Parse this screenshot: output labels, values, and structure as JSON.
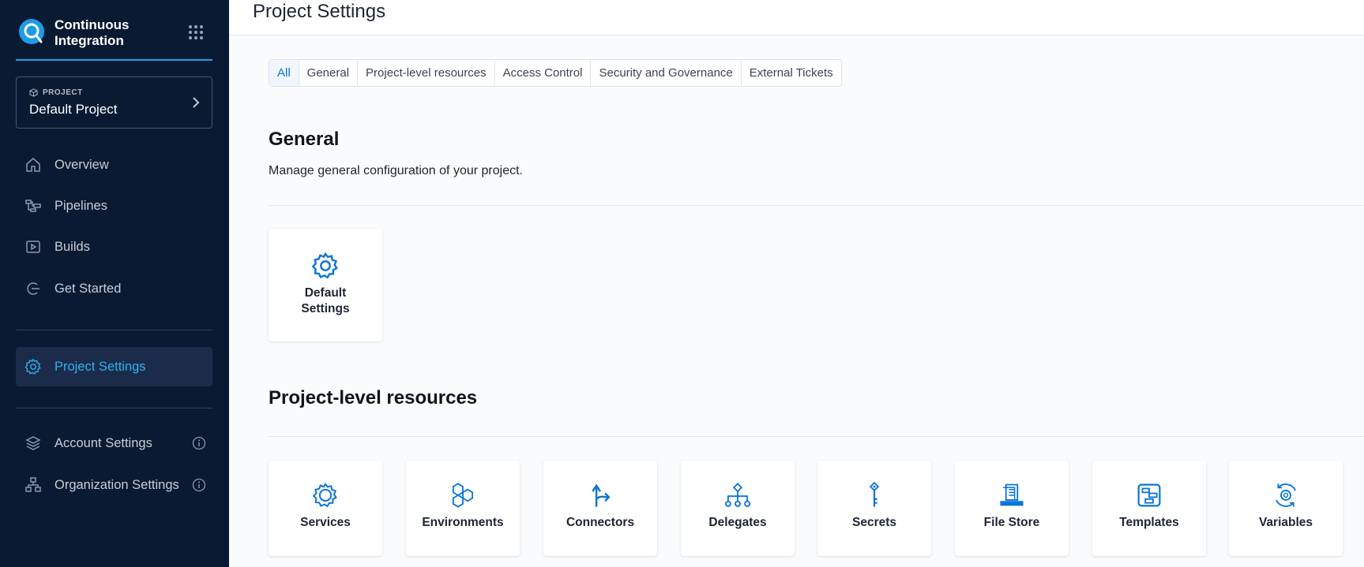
{
  "app": {
    "title": "Continuous Integration"
  },
  "sidebar": {
    "project": {
      "caption": "PROJECT",
      "name": "Default Project"
    },
    "items": [
      {
        "label": "Overview",
        "icon": "home-icon"
      },
      {
        "label": "Pipelines",
        "icon": "pipelines-icon"
      },
      {
        "label": "Builds",
        "icon": "builds-icon"
      },
      {
        "label": "Get Started",
        "icon": "get-started-icon"
      }
    ],
    "project_settings": {
      "label": "Project Settings",
      "icon": "gear-icon"
    },
    "account_settings": {
      "label": "Account Settings",
      "icon": "layers-icon"
    },
    "org_settings": {
      "label": "Organization Settings",
      "icon": "org-icon"
    }
  },
  "header": {
    "title": "Project Settings"
  },
  "tabs": [
    {
      "label": "All"
    },
    {
      "label": "General"
    },
    {
      "label": "Project-level resources"
    },
    {
      "label": "Access Control"
    },
    {
      "label": "Security and Governance"
    },
    {
      "label": "External Tickets"
    }
  ],
  "general": {
    "title": "General",
    "description": "Manage general configuration of your project.",
    "cards": [
      {
        "label": "Default Settings",
        "icon": "gear-icon"
      }
    ]
  },
  "resources": {
    "title": "Project-level resources",
    "cards": [
      {
        "label": "Services",
        "icon": "services-gear-icon"
      },
      {
        "label": "Environments",
        "icon": "environments-icon"
      },
      {
        "label": "Connectors",
        "icon": "connectors-icon"
      },
      {
        "label": "Delegates",
        "icon": "delegates-icon"
      },
      {
        "label": "Secrets",
        "icon": "key-icon"
      },
      {
        "label": "File Store",
        "icon": "file-store-icon"
      },
      {
        "label": "Templates",
        "icon": "templates-icon"
      },
      {
        "label": "Variables",
        "icon": "variables-icon"
      }
    ]
  },
  "colors": {
    "sidebar_bg": "#0b1a33",
    "accent": "#2fb2f0",
    "icon_blue": "#0b74d9"
  }
}
